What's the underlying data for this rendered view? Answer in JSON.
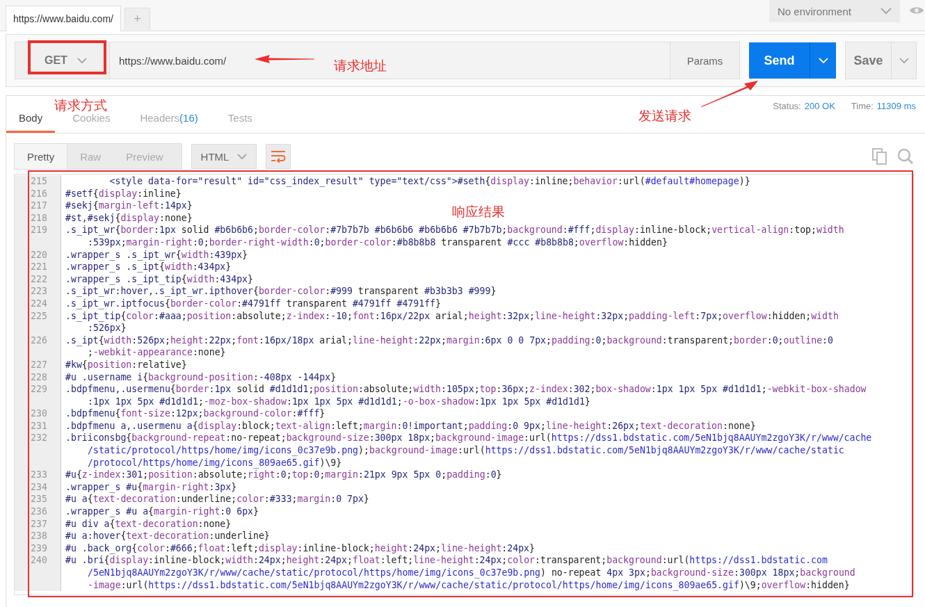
{
  "tabs": [
    {
      "label": "https://www.baidu.com/",
      "selected": true
    }
  ],
  "new_tab_button": "+",
  "environment": {
    "value": "No environment"
  },
  "request": {
    "method": "GET",
    "url": "https://www.baidu.com/",
    "params_button": "Params",
    "send_button": "Send",
    "save_button": "Save"
  },
  "response": {
    "tabs": [
      {
        "label": "Body",
        "selected": true
      },
      {
        "label": "Cookies",
        "selected": false
      },
      {
        "label": "Headers",
        "count": "(16)",
        "selected": false
      },
      {
        "label": "Tests",
        "selected": false
      }
    ],
    "status_label": "Status:",
    "status": "200 OK",
    "time_label": "Time:",
    "time": "11309 ms",
    "view_modes": [
      {
        "label": "Pretty",
        "selected": true
      },
      {
        "label": "Raw",
        "selected": false
      },
      {
        "label": "Preview",
        "selected": false
      }
    ],
    "format": "HTML",
    "code_lines": [
      {
        "number": "215",
        "rows": [
          "        <style data-for=\"result\" id=\"css_index_result\" type=\"text/css\">#seth{display:inline;behavior:url(#default#homepage)}"
        ]
      },
      {
        "number": "216",
        "rows": [
          "#setf{display:inline}"
        ]
      },
      {
        "number": "217",
        "rows": [
          "#sekj{margin-left:14px}"
        ]
      },
      {
        "number": "218",
        "rows": [
          "#st,#sekj{display:none}"
        ]
      },
      {
        "number": "219",
        "rows": [
          ".s_ipt_wr{border:1px solid #b6b6b6;border-color:#7b7b7b #b6b6b6 #b6b6b6 #7b7b7b;background:#fff;display:inline-block;vertical-align:top;width",
          ":539px;margin-right:0;border-right-width:0;border-color:#b8b8b8 transparent #ccc #b8b8b8;overflow:hidden}"
        ]
      },
      {
        "number": "220",
        "rows": [
          ".wrapper_s .s_ipt_wr{width:439px}"
        ]
      },
      {
        "number": "221",
        "rows": [
          ".wrapper_s .s_ipt{width:434px}"
        ]
      },
      {
        "number": "222",
        "rows": [
          ".wrapper_s .s_ipt_tip{width:434px}"
        ]
      },
      {
        "number": "223",
        "rows": [
          ".s_ipt_wr:hover,.s_ipt_wr.ipthover{border-color:#999 transparent #b3b3b3 #999}"
        ]
      },
      {
        "number": "224",
        "rows": [
          ".s_ipt_wr.iptfocus{border-color:#4791ff transparent #4791ff #4791ff}"
        ]
      },
      {
        "number": "225",
        "rows": [
          ".s_ipt_tip{color:#aaa;position:absolute;z-index:-10;font:16px/22px arial;height:32px;line-height:32px;padding-left:7px;overflow:hidden;width",
          ":526px}"
        ]
      },
      {
        "number": "226",
        "rows": [
          ".s_ipt{width:526px;height:22px;font:16px/18px arial;line-height:22px;margin:6px 0 0 7px;padding:0;background:transparent;border:0;outline:0",
          ";-webkit-appearance:none}"
        ]
      },
      {
        "number": "227",
        "rows": [
          "#kw{position:relative}"
        ]
      },
      {
        "number": "228",
        "rows": [
          "#u .username i{background-position:-408px -144px}"
        ]
      },
      {
        "number": "229",
        "rows": [
          ".bdpfmenu,.usermenu{border:1px solid #d1d1d1;position:absolute;width:105px;top:36px;z-index:302;box-shadow:1px 1px 5px #d1d1d1;-webkit-box-shadow",
          ":1px 1px 5px #d1d1d1;-moz-box-shadow:1px 1px 5px #d1d1d1;-o-box-shadow:1px 1px 5px #d1d1d1}"
        ]
      },
      {
        "number": "230",
        "rows": [
          ".bdpfmenu{font-size:12px;background-color:#fff}"
        ]
      },
      {
        "number": "231",
        "rows": [
          ".bdpfmenu a,.usermenu a{display:block;text-align:left;margin:0!important;padding:0 9px;line-height:26px;text-decoration:none}"
        ]
      },
      {
        "number": "232",
        "rows": [
          ".briiconsbg{background-repeat:no-repeat;background-size:300px 18px;background-image:url(https://dss1.bdstatic.com/5eN1bjq8AAUYm2zgoY3K/r/www/cache",
          "/static/protocol/https/home/img/icons_0c37e9b.png);background-image:url(https://dss1.bdstatic.com/5eN1bjq8AAUYm2zgoY3K/r/www/cache/static",
          "/protocol/https/home/img/icons_809ae65.gif)\\9}"
        ]
      },
      {
        "number": "233",
        "rows": [
          "#u{z-index:301;position:absolute;right:0;top:0;margin:21px 9px 5px 0;padding:0}"
        ]
      },
      {
        "number": "234",
        "rows": [
          ".wrapper_s #u{margin-right:3px}"
        ]
      },
      {
        "number": "235",
        "rows": [
          "#u a{text-decoration:underline;color:#333;margin:0 7px}"
        ]
      },
      {
        "number": "236",
        "rows": [
          ".wrapper_s #u a{margin-right:0 6px}"
        ]
      },
      {
        "number": "237",
        "rows": [
          "#u div a{text-decoration:none}"
        ]
      },
      {
        "number": "238",
        "rows": [
          "#u a:hover{text-decoration:underline}"
        ]
      },
      {
        "number": "239",
        "rows": [
          "#u .back_org{color:#666;float:left;display:inline-block;height:24px;line-height:24px}"
        ]
      },
      {
        "number": "240",
        "rows": [
          "#u .bri{display:inline-block;width:24px;height:24px;float:left;line-height:24px;color:transparent;background:url(https://dss1.bdstatic.com",
          "/5eN1bjq8AAUYm2zgoY3K/r/www/cache/static/protocol/https/home/img/icons_0c37e9b.png) no-repeat 4px 3px;background-size:300px 18px;background",
          "-image:url(https://dss1.bdstatic.com/5eN1bjq8AAUYm2zgoY3K/r/www/cache/static/protocol/https/home/img/icons_809ae65.gif)\\9;overflow:hidden}"
        ]
      }
    ]
  },
  "annotations": [
    {
      "text": "请求地址"
    },
    {
      "text": "请求方式"
    },
    {
      "text": "发送请求"
    },
    {
      "text": "响应结果"
    }
  ]
}
